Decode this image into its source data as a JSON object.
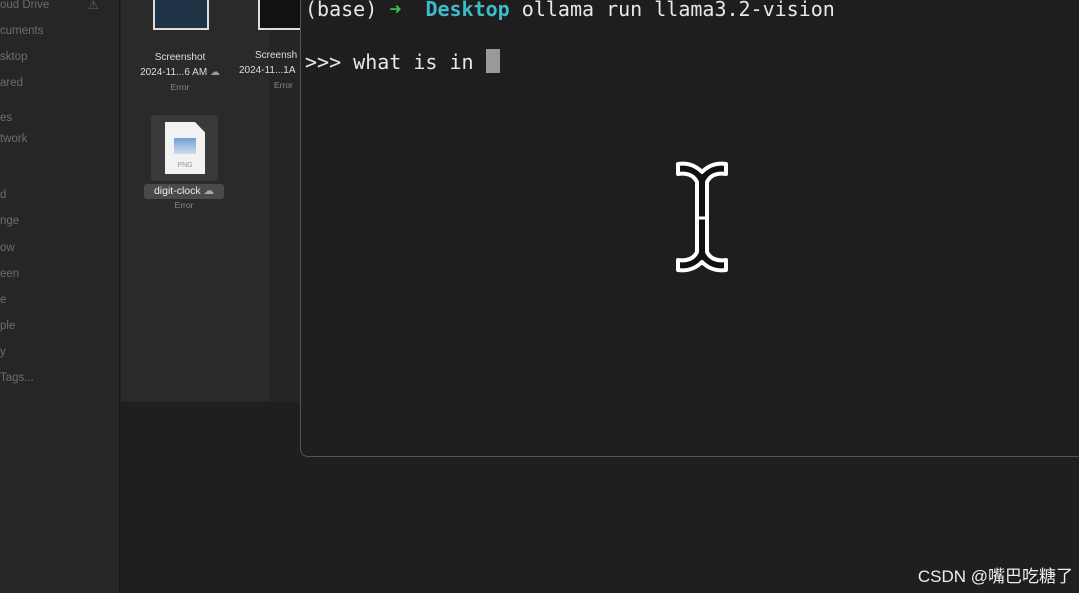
{
  "sidebar": {
    "items": [
      "oud Drive",
      "cuments",
      "sktop",
      "ared",
      "es",
      "twork",
      "d",
      "nge",
      "ow",
      "een",
      "e",
      "ple",
      "y",
      "Tags..."
    ]
  },
  "finder": {
    "files": [
      {
        "name1": "Screenshot",
        "name2": "2024-11...6 AM",
        "status": "Error"
      },
      {
        "name1": "Screensh",
        "name2": "2024-11...1A",
        "status": "Error"
      },
      {
        "name": "digit-clock",
        "type_label": "PNG",
        "status": "Error"
      }
    ]
  },
  "terminal": {
    "prompt_prefix": "(base)",
    "arrow": "➜",
    "directory": "Desktop",
    "command": "ollama run llama3.2-vision",
    "input_prompt": ">>>",
    "input_text": "what is in"
  },
  "watermark": "CSDN @嘴巴吃糖了",
  "colors": {
    "arrow": "#38c14a",
    "directory": "#3bbcc8"
  }
}
